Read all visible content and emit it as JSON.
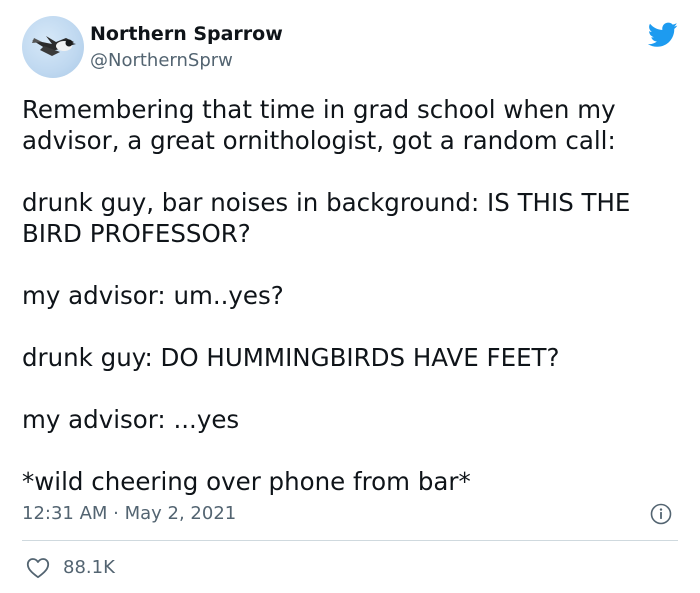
{
  "author": {
    "display_name": "Northern Sparrow",
    "handle": "@NorthernSprw",
    "avatar_icon": "sparrow-avatar-icon"
  },
  "brand": {
    "logo_icon": "twitter-bird-icon",
    "color": "#1d9bf0"
  },
  "tweet": {
    "paragraphs": [
      "Remembering that time in grad school when my advisor, a great ornithologist, got a random call:",
      "drunk guy, bar noises in background: IS THIS THE BIRD PROFESSOR?",
      "my advisor: um..yes?",
      "drunk guy: DO HUMMINGBIRDS HAVE FEET?",
      "my advisor: ...yes",
      "*wild cheering over phone from bar*"
    ],
    "timestamp": "12:31 AM · May 2, 2021"
  },
  "actions": {
    "like_icon": "heart-icon",
    "like_count": "88.1K",
    "info_icon": "info-icon"
  },
  "colors": {
    "text_primary": "#0f1419",
    "text_secondary": "#536471",
    "divider": "#cfd9de"
  }
}
